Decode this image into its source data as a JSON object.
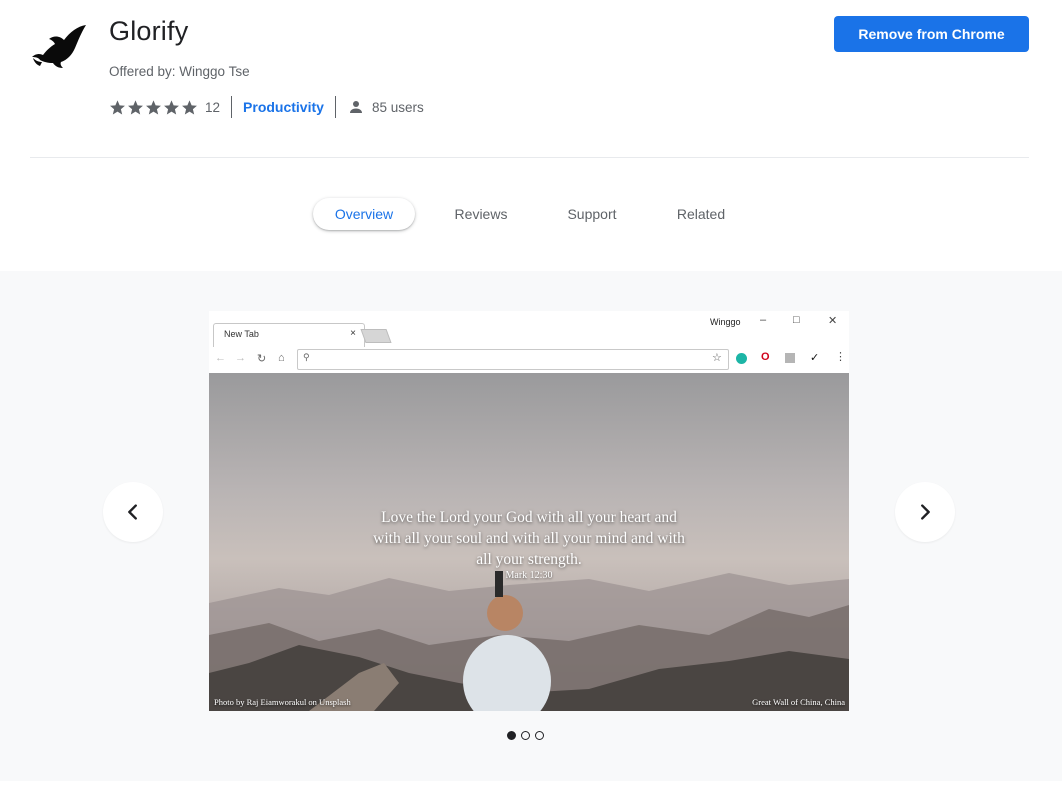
{
  "extension": {
    "name": "Glorify",
    "offered_by": "Offered by: Winggo Tse",
    "rating_count": "12",
    "category": "Productivity",
    "users": "85 users",
    "rating_stars": 5,
    "action_button": "Remove from Chrome"
  },
  "tabs": [
    {
      "label": "Overview",
      "active": true
    },
    {
      "label": "Reviews",
      "active": false
    },
    {
      "label": "Support",
      "active": false
    },
    {
      "label": "Related",
      "active": false
    }
  ],
  "gallery": {
    "slide_count": 3,
    "active_slide": 1,
    "screenshot": {
      "tab_title": "New Tab",
      "tab_close": "×",
      "profile_name": "Winggo",
      "quote_lines": [
        "Love the Lord your God with all your heart and",
        "with all your soul and with all your mind and with",
        "all your strength."
      ],
      "reference": "Mark 12:30",
      "photo_credit": "Photo by Raj Eiamworakul on Unsplash",
      "location": "Great Wall of China, China"
    }
  },
  "colors": {
    "accent": "#1a73e8",
    "text_primary": "#202124",
    "text_secondary": "#5f6368",
    "gallery_bg": "#f8f9fa"
  },
  "icons": [
    "bird-logo-icon",
    "star-icon",
    "user-icon",
    "chevron-left-icon",
    "chevron-right-icon"
  ]
}
